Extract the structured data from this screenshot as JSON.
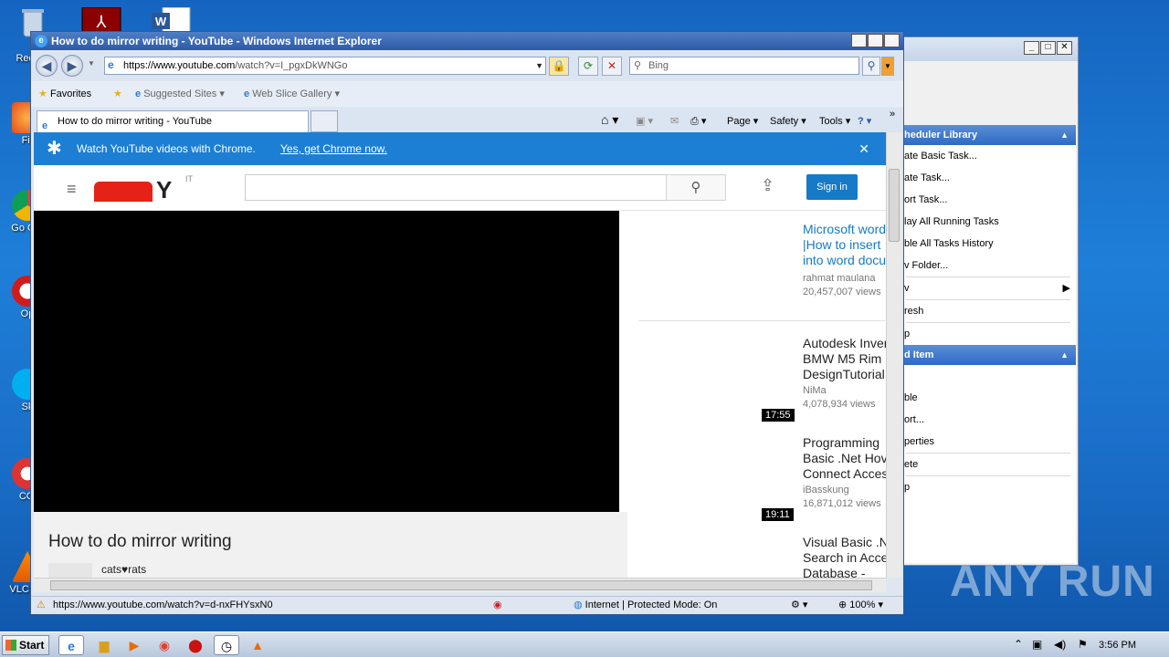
{
  "desktop": {
    "icons": [
      {
        "label": "Recy"
      },
      {
        "label": "Fir"
      },
      {
        "label": "Go Chr"
      },
      {
        "label": "Op"
      },
      {
        "label": "Sk"
      },
      {
        "label": "CCl"
      },
      {
        "label": "VLC pla"
      }
    ]
  },
  "bg_window": {
    "section1_title": "heduler Library",
    "items1": [
      "ate Basic Task...",
      "ate Task...",
      "ort Task...",
      "lay All Running Tasks",
      "ble All Tasks History",
      "v Folder...",
      "v",
      "resh",
      "p"
    ],
    "section2_title": "d Item",
    "items2": [
      "ble",
      "ort...",
      "perties",
      "ete",
      "p"
    ]
  },
  "ie": {
    "title": "How to do mirror writing - YouTube - Windows Internet Explorer",
    "url_host": "https://www.youtube.com",
    "url_rest": "/watch?v=I_pgxDkWNGo",
    "search_placeholder": "Bing",
    "favorites_label": "Favorites",
    "suggested_sites": "Suggested Sites",
    "web_slice_gallery": "Web Slice Gallery",
    "tab_title": "How to do mirror writing - YouTube",
    "cmd_page": "Page",
    "cmd_safety": "Safety",
    "cmd_tools": "Tools",
    "status_url": "https://www.youtube.com/watch?v=d-nxFHYsxN0",
    "status_zone": "Internet | Protected Mode: On",
    "status_zoom": "100%"
  },
  "youtube": {
    "promo_text": "Watch YouTube videos with Chrome.",
    "promo_link": "Yes, get Chrome now.",
    "logo_suffix": "IT",
    "signin": "Sign in",
    "video_title": "How to do mirror writing",
    "channel": "cats♥rats",
    "recommendations": [
      {
        "title_lines": [
          "Microsoft word",
          "|How to insert",
          "into word docu"
        ],
        "channel": "rahmat maulana",
        "views": "20,457,007 views",
        "duration": "",
        "title_color": "#167ac6"
      },
      {
        "title_lines": [
          "Autodesk Inver",
          "BMW M5 Rim",
          "DesignTutorial"
        ],
        "channel": "NiMa",
        "views": "4,078,934 views",
        "duration": "17:55",
        "title_color": "#222222"
      },
      {
        "title_lines": [
          "Programming",
          "Basic .Net Hov",
          "Connect Acces"
        ],
        "channel": "iBasskung",
        "views": "16,871,012 views",
        "duration": "19:11",
        "title_color": "#222222"
      },
      {
        "title_lines": [
          "Visual Basic .N",
          "Search in Acce",
          "Database -"
        ],
        "channel": "",
        "views": "",
        "duration": "",
        "title_color": "#222222"
      }
    ]
  },
  "taskbar": {
    "start_label": "Start",
    "clock": "3:56 PM"
  },
  "watermark": "ANY RUN"
}
